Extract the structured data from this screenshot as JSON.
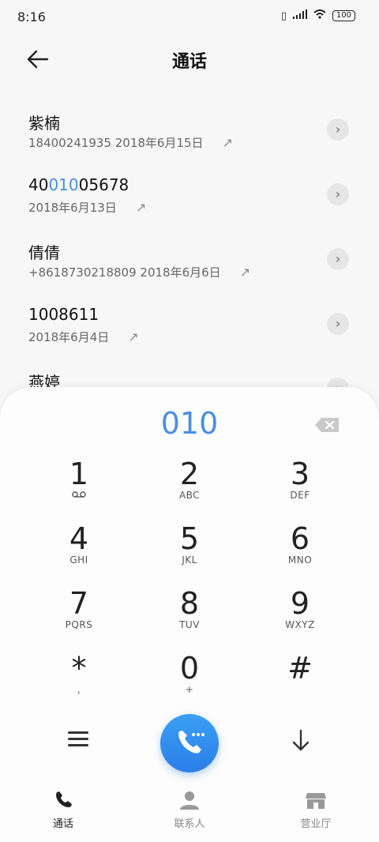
{
  "status_bar": {
    "time": "8:16",
    "battery": "100"
  },
  "header": {
    "title": "通话"
  },
  "calls": [
    {
      "name": "紫楠",
      "detail": "18400241935  2018年6月15日"
    },
    {
      "name_parts": [
        "40",
        "010",
        "05678"
      ],
      "detail": "2018年6月13日"
    },
    {
      "name": "倩倩",
      "detail": "+8618730218809  2018年6月6日"
    },
    {
      "name": "1008611",
      "detail": "2018年6月4日"
    },
    {
      "name": "燕婷",
      "detail": ""
    }
  ],
  "dialer": {
    "input": "010",
    "keys": [
      {
        "digit": "1",
        "letters": ""
      },
      {
        "digit": "2",
        "letters": "ABC"
      },
      {
        "digit": "3",
        "letters": "DEF"
      },
      {
        "digit": "4",
        "letters": "GHI"
      },
      {
        "digit": "5",
        "letters": "JKL"
      },
      {
        "digit": "6",
        "letters": "MNO"
      },
      {
        "digit": "7",
        "letters": "PQRS"
      },
      {
        "digit": "8",
        "letters": "TUV"
      },
      {
        "digit": "9",
        "letters": "WXYZ"
      },
      {
        "digit": "*",
        "letters": ","
      },
      {
        "digit": "0",
        "letters": "+"
      },
      {
        "digit": "#",
        "letters": ""
      }
    ]
  },
  "tabs": [
    {
      "label": "通话",
      "icon": "phone-icon",
      "active": true
    },
    {
      "label": "联系人",
      "icon": "person-icon",
      "active": false
    },
    {
      "label": "营业厅",
      "icon": "store-icon",
      "active": false
    }
  ],
  "colors": {
    "accent": "#4a8fe0",
    "call_button": "#2b7ee8"
  }
}
